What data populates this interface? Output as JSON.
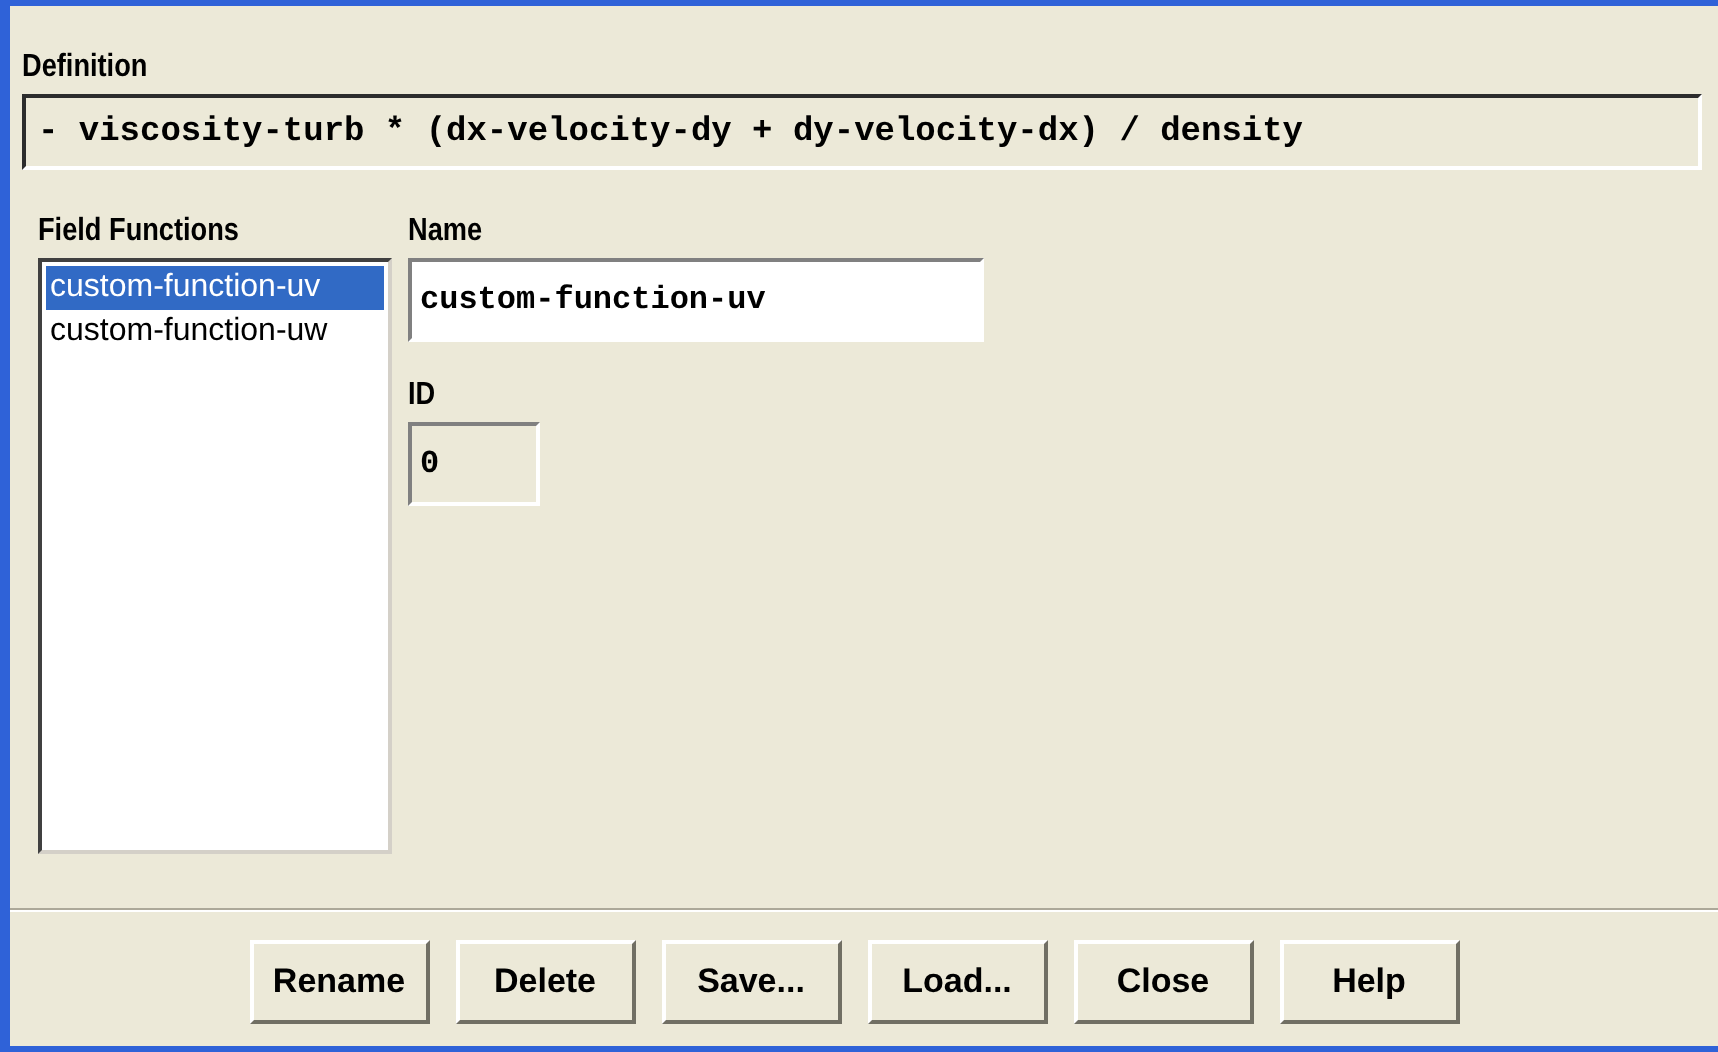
{
  "definition": {
    "label": "Definition",
    "value": "- viscosity-turb * (dx-velocity-dy + dy-velocity-dx) / density"
  },
  "field_functions": {
    "label": "Field Functions",
    "items": [
      {
        "label": "custom-function-uv",
        "selected": true
      },
      {
        "label": "custom-function-uw",
        "selected": false
      }
    ]
  },
  "name": {
    "label": "Name",
    "value": "custom-function-uv"
  },
  "id": {
    "label": "ID",
    "value": "0"
  },
  "buttons": [
    "Rename",
    "Delete",
    "Save...",
    "Load...",
    "Close",
    "Help"
  ]
}
